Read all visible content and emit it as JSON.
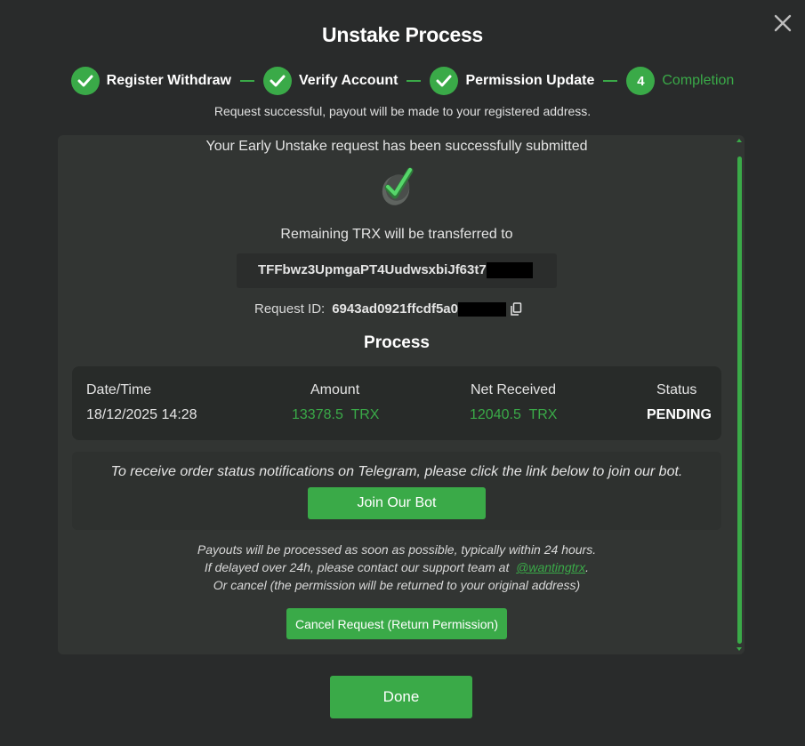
{
  "modal": {
    "title": "Unstake Process",
    "close_icon": "close-icon"
  },
  "steps": [
    {
      "label": "Register Withdraw",
      "state": "done",
      "icon": "check-icon"
    },
    {
      "label": "Verify Account",
      "state": "done",
      "icon": "check-icon"
    },
    {
      "label": "Permission Update",
      "state": "done",
      "icon": "check-icon"
    },
    {
      "label": "Completion",
      "state": "active",
      "number": "4"
    }
  ],
  "subtitle": "Request successful, payout will be made to your registered address.",
  "result": {
    "message": "Your Early Unstake request has been successfully submitted",
    "success_icon": "success-check-icon",
    "remaining_text": "Remaining TRX will be transferred to",
    "address": "TFFbwz3UpmgaPT4UudwsxbiJf63t7",
    "request_id_label": "Request ID:",
    "request_id": "6943ad0921ffcdf5a0",
    "copy_icon": "copy-icon"
  },
  "process": {
    "title": "Process",
    "headers": {
      "datetime": "Date/Time",
      "amount": "Amount",
      "net": "Net Received",
      "status": "Status"
    },
    "row": {
      "datetime": "18/12/2025 14:28",
      "amount": "13378.5  TRX",
      "net": "12040.5  TRX",
      "status": "PENDING"
    }
  },
  "telegram": {
    "text": "To receive order status notifications on Telegram, please click the link below to join our bot.",
    "button": "Join Our Bot"
  },
  "payout_info": {
    "line1": "Payouts will be processed as soon as possible, typically within 24 hours.",
    "line2_prefix": "If delayed over 24h, please contact our support team at",
    "support_handle": "@wantingtrx",
    "line2_suffix": ".",
    "line3": "Or cancel (the permission will be returned to your original address)"
  },
  "buttons": {
    "cancel": "Cancel Request (Return Permission)",
    "done": "Done"
  },
  "colors": {
    "accent": "#3aaa48",
    "background": "#292b2b",
    "panel": "#323533"
  }
}
